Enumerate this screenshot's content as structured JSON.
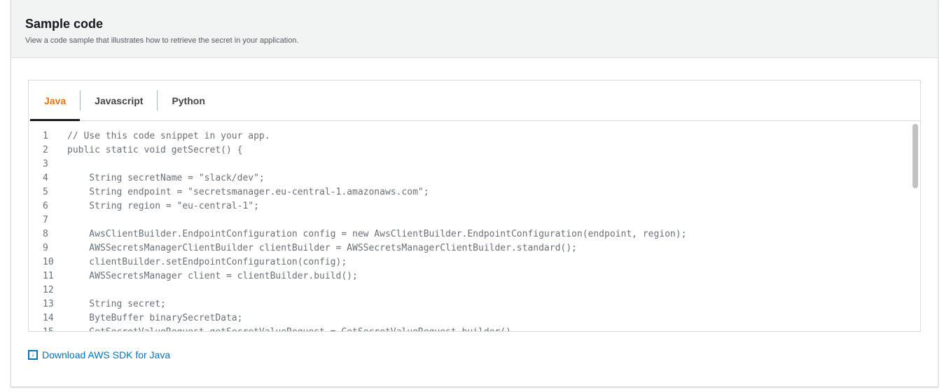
{
  "header": {
    "title": "Sample code",
    "description": "View a code sample that illustrates how to retrieve the secret in your application."
  },
  "tabs": [
    {
      "label": "Java",
      "active": true
    },
    {
      "label": "Javascript",
      "active": false
    },
    {
      "label": "Python",
      "active": false
    }
  ],
  "code_lines": [
    "// Use this code snippet in your app.",
    "public static void getSecret() {",
    "",
    "    String secretName = \"slack/dev\";",
    "    String endpoint = \"secretsmanager.eu-central-1.amazonaws.com\";",
    "    String region = \"eu-central-1\";",
    "",
    "    AwsClientBuilder.EndpointConfiguration config = new AwsClientBuilder.EndpointConfiguration(endpoint, region);",
    "    AWSSecretsManagerClientBuilder clientBuilder = AWSSecretsManagerClientBuilder.standard();",
    "    clientBuilder.setEndpointConfiguration(config);",
    "    AWSSecretsManager client = clientBuilder.build();",
    "",
    "    String secret;",
    "    ByteBuffer binarySecretData;",
    "    GetSecretValueRequest getSecretValueRequest = GetSecretValueRequest.builder()"
  ],
  "download_link": "Download AWS SDK for Java"
}
